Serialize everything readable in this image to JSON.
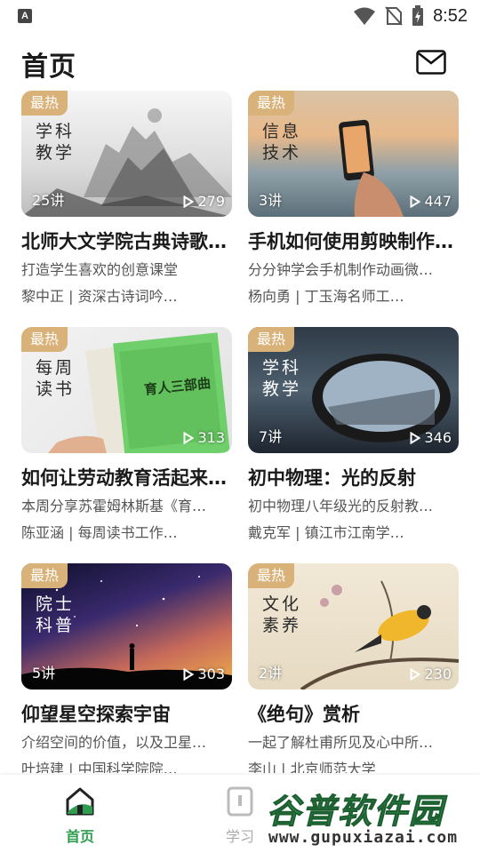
{
  "status_bar": {
    "app_badge": "A",
    "time": "8:52"
  },
  "header": {
    "title": "首页"
  },
  "badge_label": "最热",
  "courses": [
    {
      "calligraphy": "学科\n教学",
      "calligraphy_color": "#2a2a2a",
      "lessons": "25讲",
      "plays": "279",
      "title": "北师大文学院古典诗歌…",
      "subtitle": "打造学生喜欢的创意课堂",
      "author": "黎中正 | 资深古诗词吟…"
    },
    {
      "calligraphy": "信息\n技术",
      "calligraphy_color": "#2a2a2a",
      "lessons": "3讲",
      "plays": "447",
      "title": "手机如何使用剪映制作…",
      "subtitle": "分分钟学会手机制作动画微…",
      "author": "杨向勇 | 丁玉海名师工…"
    },
    {
      "calligraphy": "每周\n读书",
      "calligraphy_color": "#2a2a2a",
      "lessons": "",
      "plays": "313",
      "title": "如何让劳动教育活起来…",
      "subtitle": "本周分享苏霍姆林斯基《育…",
      "author": "陈亚涵 | 每周读书工作…"
    },
    {
      "calligraphy": "学科\n教学",
      "calligraphy_color": "#ffffff",
      "lessons": "7讲",
      "plays": "346",
      "title": "初中物理：光的反射",
      "subtitle": "初中物理八年级光的反射教…",
      "author": "戴克军 | 镇江市江南学…"
    },
    {
      "calligraphy": "院士\n科普",
      "calligraphy_color": "#ffffff",
      "lessons": "5讲",
      "plays": "303",
      "title": "仰望星空探索宇宙",
      "subtitle": "介绍空间的价值，以及卫星…",
      "author": "叶培建 | 中国科学院院…"
    },
    {
      "calligraphy": "文化\n素养",
      "calligraphy_color": "#2a2a2a",
      "lessons": "2讲",
      "plays": "230",
      "title": "《绝句》赏析",
      "subtitle": "一起了解杜甫所见及心中所…",
      "author": "李山 | 北京师范大学"
    }
  ],
  "book_cover_text": "育人三部曲",
  "bottom_nav": [
    {
      "label": "首页",
      "icon": "home-icon",
      "active": true
    },
    {
      "label": "学习",
      "icon": "study-icon",
      "active": false
    }
  ],
  "watermark": {
    "title": "谷普软件园",
    "url": "www.gupuxiazai.com"
  },
  "colors": {
    "accent": "#2e9d4f",
    "badge": "#d9b27a",
    "text": "#1a1a1a",
    "muted": "#555555"
  }
}
